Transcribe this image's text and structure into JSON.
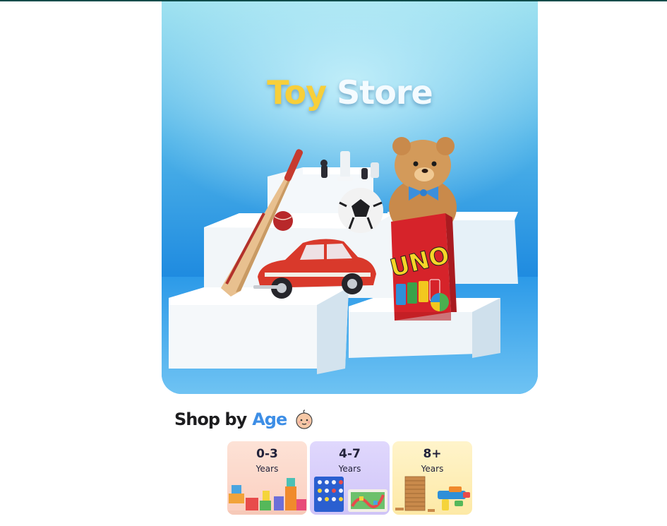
{
  "hero": {
    "title_word1": "Toy",
    "title_word2": "Store",
    "product_label": "UNO"
  },
  "section": {
    "title_part1": "Shop by",
    "title_part2": "Age",
    "icon": "baby-face-icon"
  },
  "age_groups": [
    {
      "range": "0-3",
      "unit": "Years"
    },
    {
      "range": "4-7",
      "unit": "Years"
    },
    {
      "range": "8+",
      "unit": "Years"
    }
  ],
  "colors": {
    "accent_blue": "#3d8ee6",
    "title_yellow": "#f7cf3a",
    "card_peach": "#fcd9cf",
    "card_lavender": "#d9d1fb",
    "card_yellow": "#fdf1c4"
  }
}
